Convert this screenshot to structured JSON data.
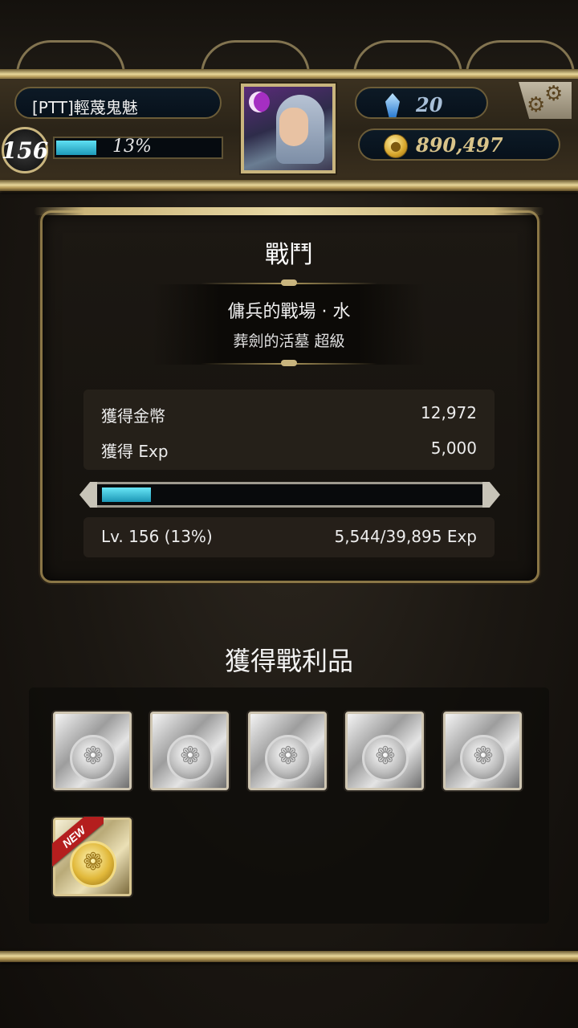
{
  "player": {
    "name": "[PTT]輕蔑鬼魅",
    "level": "156",
    "exp_percent_label": "13%",
    "exp_fraction": 0.13,
    "gems": "20",
    "gold": "890,497"
  },
  "icons": {
    "settings": "gears-icon",
    "gem": "gem-icon",
    "coin": "coin-icon"
  },
  "battle": {
    "title": "戰鬥",
    "stage_name": "傭兵的戰場 · 水",
    "stage_difficulty": "葬劍的活墓 超級",
    "rewards": [
      {
        "label": "獲得金幣",
        "value": "12,972"
      },
      {
        "label": "獲得 Exp",
        "value": "5,000"
      }
    ],
    "level_label": "Lv. 156 (13%)",
    "exp_label": "5,544/39,895 Exp",
    "exp_fraction": 0.13
  },
  "loot": {
    "title": "獲得戰利品",
    "new_badge": "NEW",
    "items": [
      {
        "type": "silver-coin-card"
      },
      {
        "type": "silver-coin-card"
      },
      {
        "type": "silver-coin-card"
      },
      {
        "type": "silver-coin-card"
      },
      {
        "type": "silver-coin-card"
      },
      {
        "type": "gold-coin-card",
        "is_new": true
      }
    ]
  },
  "colors": {
    "exp_bar": "#1e9ab8",
    "gold_trim": "#c9b57e",
    "new_badge": "#b41e1e"
  }
}
